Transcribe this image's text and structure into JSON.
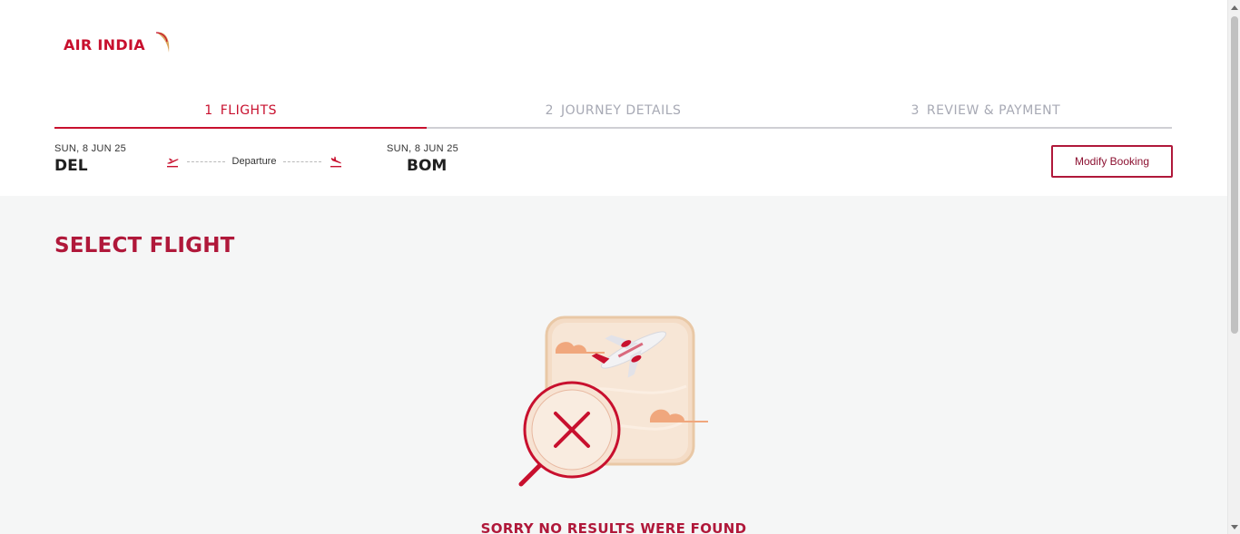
{
  "brand": {
    "logo_text": "AIR INDIA",
    "primary_color": "#c8102e",
    "accent_color": "#b0183a"
  },
  "stepper": [
    {
      "number": "1",
      "label": "FLIGHTS",
      "active": true
    },
    {
      "number": "2",
      "label": "JOURNEY DETAILS",
      "active": false
    },
    {
      "number": "3",
      "label": "REVIEW & PAYMENT",
      "active": false
    }
  ],
  "journey": {
    "origin": {
      "date": "SUN, 8 JUN 25",
      "code": "DEL"
    },
    "destination": {
      "date": "SUN, 8 JUN 25",
      "code": "BOM"
    },
    "route_label": "Departure",
    "modify_button": "Modify Booking"
  },
  "main": {
    "title": "SELECT FLIGHT",
    "empty_message": "SORRY NO RESULTS WERE FOUND"
  }
}
